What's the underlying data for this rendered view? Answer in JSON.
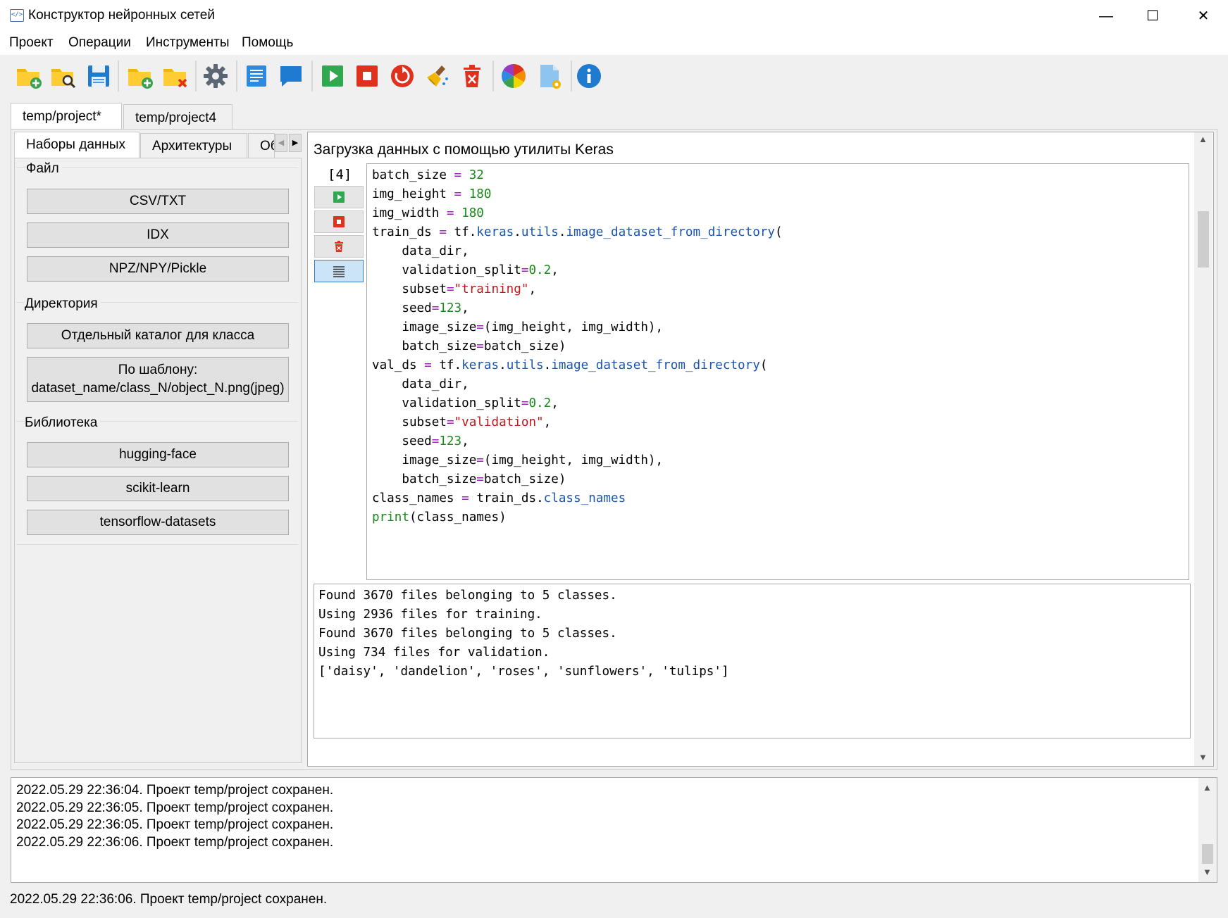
{
  "window": {
    "title": "Конструктор нейронных сетей",
    "icon_text": "</>",
    "minimize": "—",
    "maximize": "☐",
    "close": "✕"
  },
  "menu": [
    "Проект",
    "Операции",
    "Инструменты",
    "Помощь"
  ],
  "toolbar": [
    {
      "name": "new-project-icon"
    },
    {
      "name": "open-project-icon"
    },
    {
      "name": "save-icon"
    },
    {
      "name": "add-folder-icon"
    },
    {
      "name": "delete-folder-icon"
    },
    {
      "name": "settings-gear-icon"
    },
    {
      "name": "text-cell-icon"
    },
    {
      "name": "comment-icon"
    },
    {
      "name": "run-icon"
    },
    {
      "name": "stop-icon"
    },
    {
      "name": "restart-icon"
    },
    {
      "name": "clear-output-icon"
    },
    {
      "name": "delete-cell-icon"
    },
    {
      "name": "color-palette-icon"
    },
    {
      "name": "document-settings-icon"
    },
    {
      "name": "info-icon"
    }
  ],
  "project_tabs": [
    "temp/project*",
    "temp/project4"
  ],
  "left_tabs": [
    "Наборы данных",
    "Архитектуры",
    "Об"
  ],
  "groups": {
    "file": {
      "title": "Файл",
      "buttons": [
        "CSV/TXT",
        "IDX",
        "NPZ/NPY/Pickle"
      ]
    },
    "dir": {
      "title": "Директория",
      "buttons": [
        "Отдельный каталог для класса",
        "По шаблону:",
        "dataset_name/class_N/object_N.png(jpeg)"
      ]
    },
    "lib": {
      "title": "Библиотека",
      "buttons": [
        "hugging-face",
        "scikit-learn",
        "tensorflow-datasets"
      ]
    }
  },
  "cell": {
    "title": "Загрузка данных с помощью утилиты Keras",
    "index": "[4]",
    "code": {
      "l1": [
        "batch_size",
        " = ",
        "32"
      ],
      "l2": [
        "img_height",
        " = ",
        "180"
      ],
      "l3": [
        "img_width",
        " = ",
        "180"
      ],
      "l4": [
        "train_ds",
        " = ",
        "tf",
        ".",
        "keras",
        ".",
        "utils",
        ".",
        "image_dataset_from_directory",
        "("
      ],
      "l5": [
        "    data_dir,"
      ],
      "l6": [
        "    validation_split",
        "=",
        "0.2",
        ","
      ],
      "l7": [
        "    subset",
        "=",
        "\"training\"",
        ","
      ],
      "l8": [
        "    seed",
        "=",
        "123",
        ","
      ],
      "l9": [
        "    image_size",
        "=",
        "(img_height, img_width),"
      ],
      "l10": [
        "    batch_size",
        "=",
        "batch_size)"
      ],
      "l11": [
        "val_ds",
        " = ",
        "tf",
        ".",
        "keras",
        ".",
        "utils",
        ".",
        "image_dataset_from_directory",
        "("
      ],
      "l12": [
        "    data_dir,"
      ],
      "l13": [
        "    validation_split",
        "=",
        "0.2",
        ","
      ],
      "l14": [
        "    subset",
        "=",
        "\"validation\"",
        ","
      ],
      "l15": [
        "    seed",
        "=",
        "123",
        ","
      ],
      "l16": [
        "    image_size",
        "=",
        "(img_height, img_width),"
      ],
      "l17": [
        "    batch_size",
        "=",
        "batch_size)"
      ],
      "l18": [
        "class_names",
        " = ",
        "train_ds",
        ".",
        "class_names"
      ],
      "l19": [
        "print",
        "(class_names)"
      ]
    },
    "output": [
      "Found 3670 files belonging to 5 classes.",
      "Using 2936 files for training.",
      "Found 3670 files belonging to 5 classes.",
      "Using 734 files for validation.",
      "['daisy', 'dandelion', 'roses', 'sunflowers', 'tulips']"
    ]
  },
  "log": [
    "2022.05.29 22:36:04. Проект temp/project сохранен.",
    "2022.05.29 22:36:05. Проект temp/project сохранен.",
    "2022.05.29 22:36:05. Проект temp/project сохранен.",
    "2022.05.29 22:36:06. Проект temp/project сохранен."
  ],
  "status": "2022.05.29 22:36:06. Проект temp/project сохранен."
}
